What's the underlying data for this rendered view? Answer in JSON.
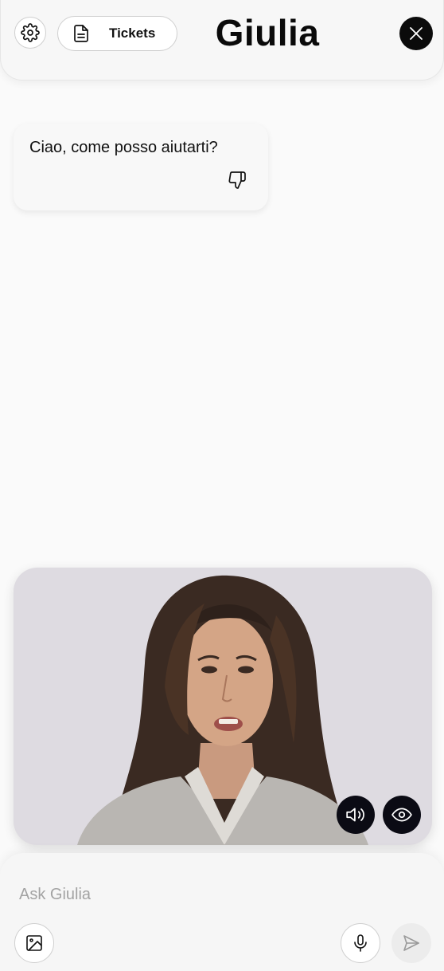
{
  "header": {
    "title": "Giulia",
    "tickets_label": "Tickets"
  },
  "chat": {
    "messages": [
      {
        "text": "Ciao, come posso aiutarti?",
        "feedback_icon": "thumbs-down-icon"
      }
    ]
  },
  "composer": {
    "placeholder": "Ask Giulia"
  },
  "icons": {
    "settings": "gear-icon",
    "tickets": "document-icon",
    "close": "close-icon",
    "sound": "speaker-icon",
    "visibility": "eye-icon",
    "image": "image-icon",
    "mic": "microphone-icon",
    "send": "send-icon"
  },
  "colors": {
    "background": "#fafafa",
    "accent_dark": "#0b0b0b",
    "video_bg": "#dedbe1",
    "placeholder": "#a3a3a3"
  }
}
